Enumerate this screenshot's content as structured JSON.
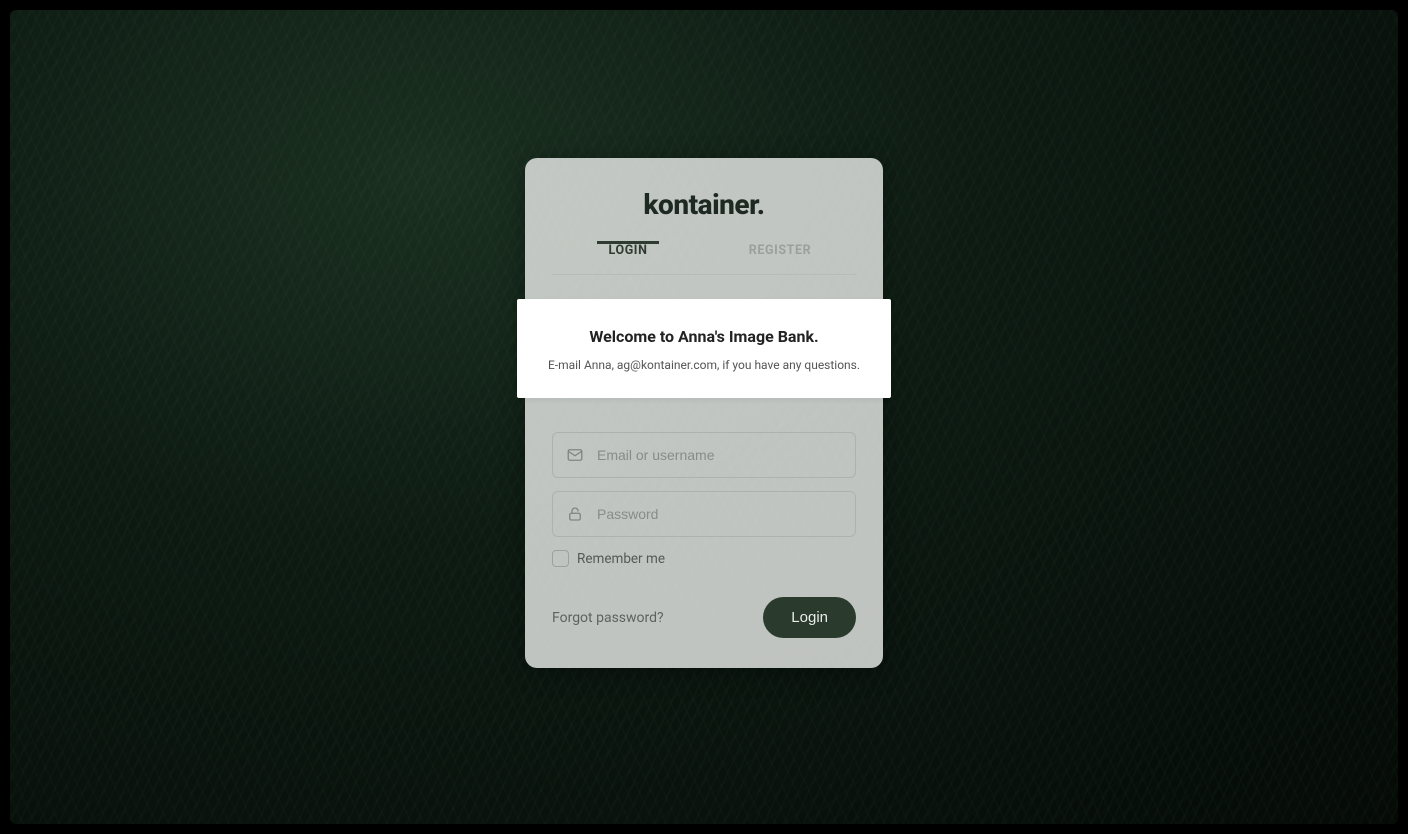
{
  "logo": {
    "text": "kontainer"
  },
  "tabs": {
    "login": "LOGIN",
    "register": "REGISTER",
    "active": "login"
  },
  "welcome": {
    "title": "Welcome to Anna's Image Bank.",
    "subtitle": "E-mail Anna, ag@kontainer.com, if you have any questions."
  },
  "form": {
    "email_placeholder": "Email or username",
    "password_placeholder": "Password",
    "remember_label": "Remember me",
    "forgot_label": "Forgot password?",
    "submit_label": "Login"
  },
  "colors": {
    "accent": "#2a3a2d",
    "card_bg": "rgba(232,234,232,0.82)",
    "banner_bg": "#ffffff"
  }
}
